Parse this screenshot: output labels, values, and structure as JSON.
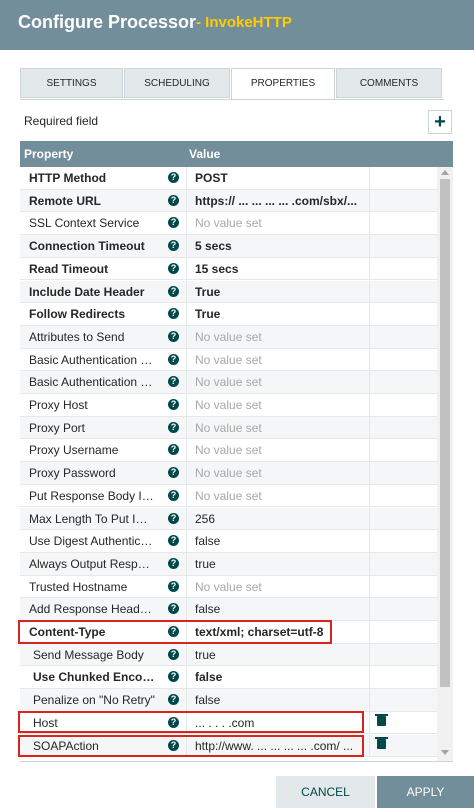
{
  "dialog": {
    "title": "Configure Processor",
    "subtitle": "- InvokeHTTP"
  },
  "tabs": [
    {
      "label": "SETTINGS",
      "active": false
    },
    {
      "label": "SCHEDULING",
      "active": false
    },
    {
      "label": "PROPERTIES",
      "active": true
    },
    {
      "label": "COMMENTS",
      "active": false
    }
  ],
  "required_label": "Required field",
  "add_icon": "+",
  "grid": {
    "columns": [
      "Property",
      "Value"
    ],
    "rows": [
      {
        "name": "HTTP Method",
        "value": "POST",
        "bold": true,
        "unset": false
      },
      {
        "name": "Remote URL",
        "value": "https://   ...   ...  ...  ... .com/sbx/...",
        "bold": true,
        "unset": false
      },
      {
        "name": "SSL Context Service",
        "value": "No value set",
        "bold": false,
        "unset": true
      },
      {
        "name": "Connection Timeout",
        "value": "5 secs",
        "bold": true,
        "unset": false
      },
      {
        "name": "Read Timeout",
        "value": "15 secs",
        "bold": true,
        "unset": false
      },
      {
        "name": "Include Date Header",
        "value": "True",
        "bold": true,
        "unset": false
      },
      {
        "name": "Follow Redirects",
        "value": "True",
        "bold": true,
        "unset": false
      },
      {
        "name": "Attributes to Send",
        "value": "No value set",
        "bold": false,
        "unset": true
      },
      {
        "name": "Basic Authentication U...",
        "value": "No value set",
        "bold": false,
        "unset": true
      },
      {
        "name": "Basic Authentication P...",
        "value": "No value set",
        "bold": false,
        "unset": true
      },
      {
        "name": "Proxy Host",
        "value": "No value set",
        "bold": false,
        "unset": true
      },
      {
        "name": "Proxy Port",
        "value": "No value set",
        "bold": false,
        "unset": true
      },
      {
        "name": "Proxy Username",
        "value": "No value set",
        "bold": false,
        "unset": true
      },
      {
        "name": "Proxy Password",
        "value": "No value set",
        "bold": false,
        "unset": true
      },
      {
        "name": "Put Response Body In ...",
        "value": "No value set",
        "bold": false,
        "unset": true
      },
      {
        "name": "Max Length To Put In ...",
        "value": "256",
        "bold": false,
        "unset": false
      },
      {
        "name": "Use Digest Authentica...",
        "value": "false",
        "bold": false,
        "unset": false
      },
      {
        "name": "Always Output Respon...",
        "value": "true",
        "bold": false,
        "unset": false
      },
      {
        "name": "Trusted Hostname",
        "value": "No value set",
        "bold": false,
        "unset": true
      },
      {
        "name": "Add Response Header...",
        "value": "false",
        "bold": false,
        "unset": false
      },
      {
        "name": "Content-Type",
        "value": "text/xml; charset=utf-8",
        "bold": true,
        "unset": false
      },
      {
        "name": "Send Message Body",
        "value": "true",
        "bold": false,
        "unset": false
      },
      {
        "name": "Use Chunked Encoding",
        "value": "false",
        "bold": true,
        "unset": false
      },
      {
        "name": "Penalize on \"No Retry\"",
        "value": "false",
        "bold": false,
        "unset": false
      },
      {
        "name": "Host",
        "value": "...   .     .  .      .com",
        "bold": false,
        "unset": false,
        "deletable": true
      },
      {
        "name": "SOAPAction",
        "value": "http://www. ... ... ... ... .com/ ...",
        "bold": false,
        "unset": false,
        "deletable": true
      }
    ]
  },
  "buttons": {
    "cancel": "CANCEL",
    "apply": "APPLY"
  },
  "colors": {
    "header_bg": "#728e9b",
    "subtitle": "#ffcc00",
    "highlight": "#d9231d",
    "accent": "#004849"
  }
}
